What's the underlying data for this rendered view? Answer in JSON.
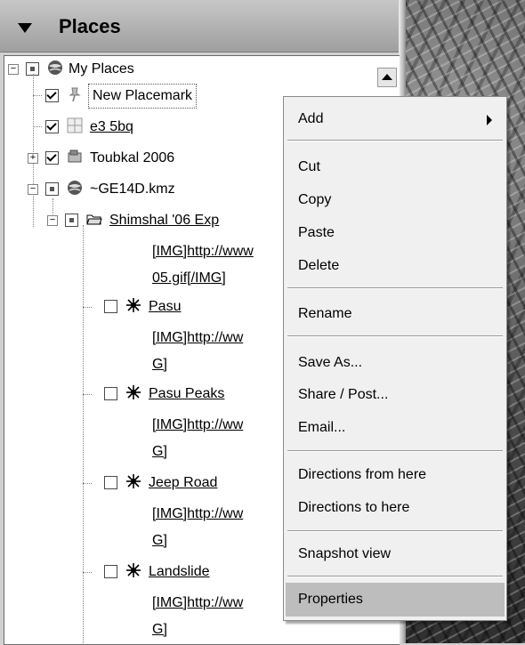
{
  "panel": {
    "title": "Places"
  },
  "tree": {
    "my_places": "My Places",
    "new_placemark": "New Placemark",
    "e3": "e3 5bq",
    "toubkal": "Toubkal 2006",
    "ge14d": "~GE14D.kmz",
    "shimshal": "Shimshal '06 Exp",
    "shimshal_desc_1": "[IMG]http://www",
    "shimshal_desc_2": "05.gif[/IMG]",
    "pasu": "Pasu",
    "pasu_desc_1": "[IMG]http://ww",
    "pasu_desc_2": "G]",
    "pasu_peaks": "Pasu Peaks",
    "pasu_peaks_desc_1": "[IMG]http://ww",
    "pasu_peaks_desc_2": "G]",
    "jeep_road": "Jeep Road",
    "jeep_road_desc_1": "[IMG]http://ww",
    "jeep_road_desc_2": "G]",
    "landslide": "Landslide",
    "landslide_desc_1": "[IMG]http://ww",
    "landslide_desc_2": "G]"
  },
  "context_menu": {
    "add": "Add",
    "cut": "Cut",
    "copy": "Copy",
    "paste": "Paste",
    "delete": "Delete",
    "rename": "Rename",
    "save_as": "Save As...",
    "share": "Share / Post...",
    "email": "Email...",
    "directions_from": "Directions from here",
    "directions_to": "Directions to here",
    "snapshot": "Snapshot view",
    "properties": "Properties"
  }
}
